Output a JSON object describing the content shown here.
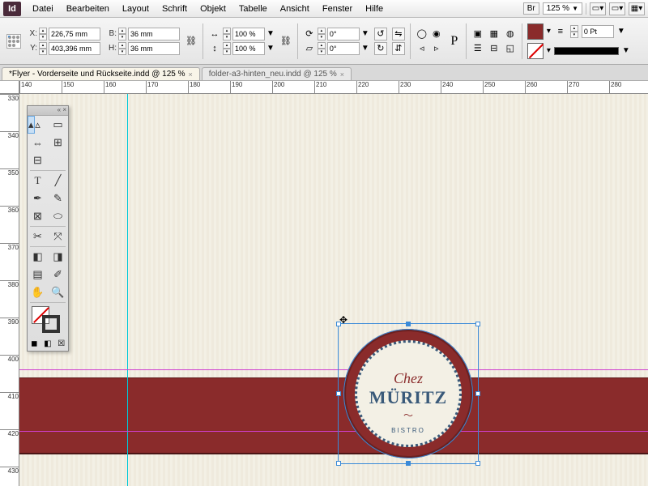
{
  "menu": {
    "items": [
      "Datei",
      "Bearbeiten",
      "Layout",
      "Schrift",
      "Objekt",
      "Tabelle",
      "Ansicht",
      "Fenster",
      "Hilfe"
    ],
    "br": "Br",
    "zoom": "125 %"
  },
  "ctrl": {
    "x_lbl": "X:",
    "x": "226,75 mm",
    "y_lbl": "Y:",
    "y": "403,396 mm",
    "w_lbl": "B:",
    "w": "36 mm",
    "h_lbl": "H:",
    "h": "36 mm",
    "sx": "100 %",
    "sy": "100 %",
    "rot": "0°",
    "shear": "0°",
    "stroke": "0 Pt"
  },
  "tabs": {
    "t1": "*Flyer - Vorderseite und Rückseite.indd @ 125 %",
    "t2": "folder-a3-hinten_neu.indd @ 125 %"
  },
  "hruler": [
    "140",
    "150",
    "160",
    "170",
    "180",
    "190",
    "200",
    "210",
    "220",
    "230",
    "240",
    "250",
    "260",
    "270",
    "280"
  ],
  "vruler": [
    "330",
    "340",
    "350",
    "360",
    "370",
    "380",
    "390",
    "400",
    "410",
    "420",
    "430"
  ],
  "logo": {
    "chez": "Chez",
    "muritz": "MÜRITZ",
    "bistro": "BISTRO"
  }
}
